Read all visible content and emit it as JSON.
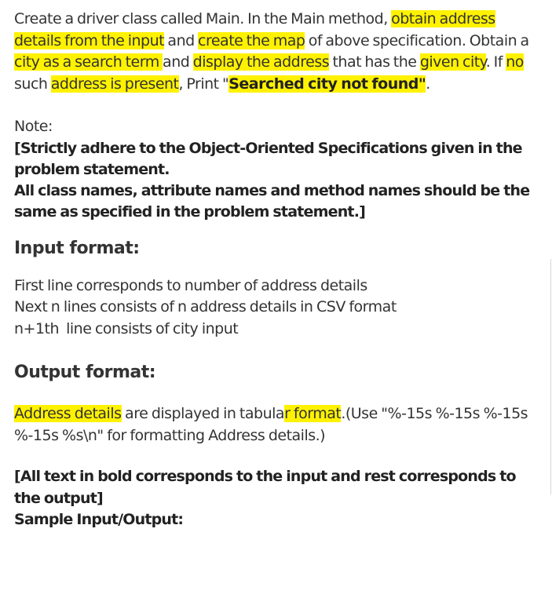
{
  "intro": {
    "t1": "Create a driver class called Main. In the Main method, ",
    "h1": "obtain address details from the input",
    "t2": " and ",
    "h2": "create the map",
    "t3": " of above specification. Obtain a ",
    "h3": "city as a search term ",
    "t4": "and ",
    "h4": "display the address",
    "t5": " that has the ",
    "h5": "given city",
    "t6": ". If ",
    "h6": "no",
    "t7": " such ",
    "h7": "address is present",
    "t8": ", Print \"",
    "h8": "Searched city not found\"",
    "t9": "."
  },
  "note": {
    "label": "Note:",
    "line1": "[Strictly adhere to the Object-Oriented Specifications given in the problem statement.",
    "line2": "All class names, attribute names and method names should be the same as specified in the problem statement.]"
  },
  "input_format": {
    "title": "Input format:",
    "line1": "First line corresponds to number of address details",
    "line2": "Next n lines consists of n address details in CSV format",
    "line3": "n+1th  line consists of city input"
  },
  "output_format": {
    "title": "Output format:",
    "h1": "Address details",
    "t1": " are displayed in tabula",
    "h2": "r format",
    "t2": ".(Use \"%-15s %-15s %-15s %-15s %s\\n\" for formatting Address details.)"
  },
  "bottom": {
    "line1": "[All text in bold corresponds to the input and rest corresponds to the output]",
    "line2": "Sample Input/Output:"
  }
}
